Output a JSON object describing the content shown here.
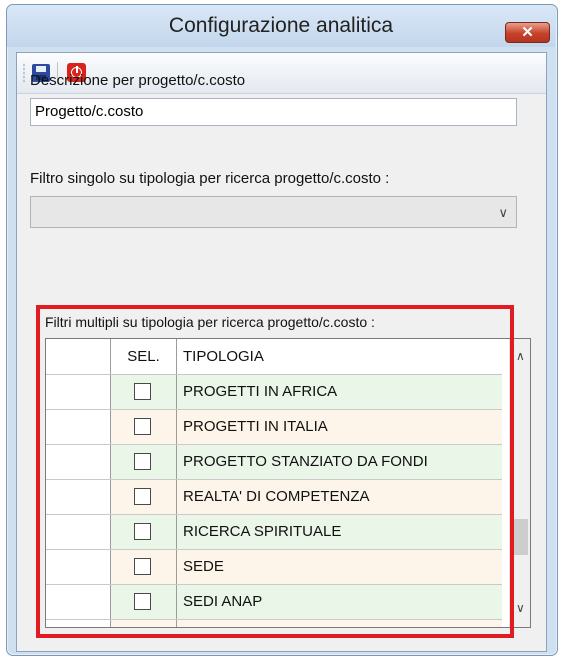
{
  "window": {
    "title": "Configurazione analitica",
    "close_glyph": "✕"
  },
  "toolbar": {
    "save_icon": "floppy-disk-icon",
    "exit_icon": "power-exit-icon"
  },
  "form": {
    "descrizione_label": "Descrizione per progetto/c.costo",
    "descrizione_value": "Progetto/c.costo",
    "filtro_singolo_label": "Filtro singolo su tipologia per ricerca progetto/c.costo :",
    "filtro_singolo_value": "",
    "filtri_multipli_label": "Filtri multipli su tipologia per ricerca progetto/c.costo :"
  },
  "grid": {
    "columns": [
      "SEL.",
      "TIPOLOGIA"
    ],
    "rows": [
      {
        "selected": false,
        "tipologia": "PROGETTI IN AFRICA"
      },
      {
        "selected": false,
        "tipologia": "PROGETTI IN ITALIA"
      },
      {
        "selected": false,
        "tipologia": "PROGETTO STANZIATO DA FONDI"
      },
      {
        "selected": false,
        "tipologia": "REALTA' DI COMPETENZA"
      },
      {
        "selected": false,
        "tipologia": "RICERCA SPIRITUALE"
      },
      {
        "selected": false,
        "tipologia": "SEDE"
      },
      {
        "selected": false,
        "tipologia": "SEDI ANAP"
      }
    ]
  },
  "colors": {
    "highlight": "#e11b22",
    "row_green": "#eaf6e8",
    "row_beige": "#fdf5ea",
    "close_red": "#c7412a"
  }
}
